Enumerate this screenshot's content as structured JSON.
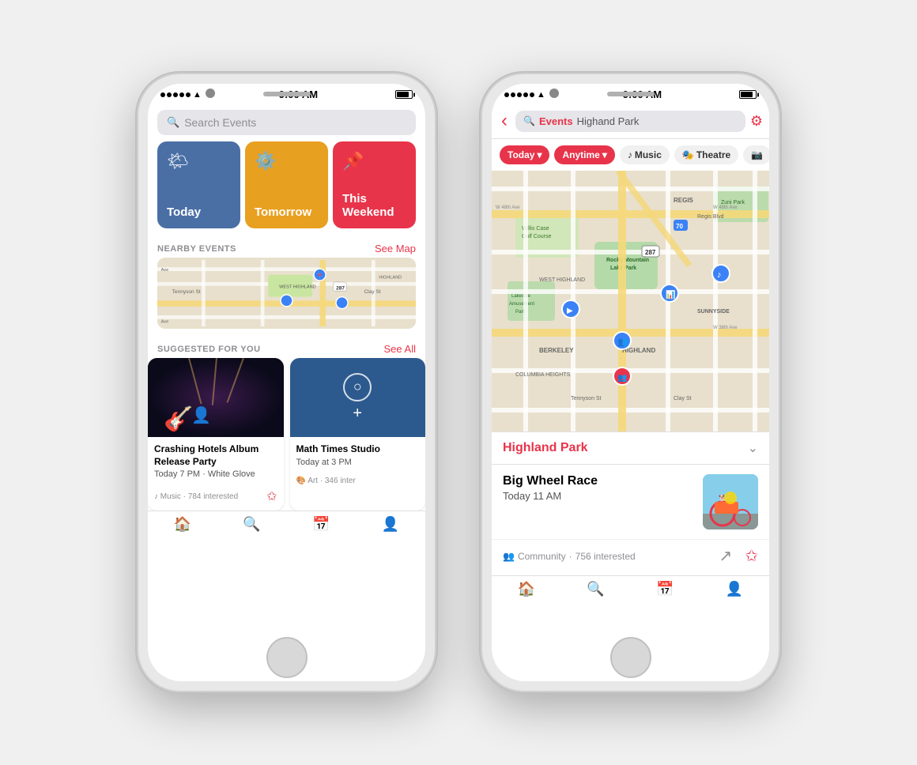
{
  "phone1": {
    "status": {
      "dots": 5,
      "wifi": "wifi",
      "time": "9:00 AM",
      "battery": "full"
    },
    "search": {
      "placeholder": "Search Events"
    },
    "timeCards": [
      {
        "id": "today",
        "label": "Today",
        "icon": "☁️",
        "color": "#4a6fa5"
      },
      {
        "id": "tomorrow",
        "label": "Tomorrow",
        "icon": "⚙️",
        "color": "#e8a020"
      },
      {
        "id": "weekend",
        "label": "This Weekend",
        "icon": "📌",
        "color": "#e8344a"
      }
    ],
    "nearby": {
      "title": "NEARBY EVENTS",
      "link": "See Map"
    },
    "suggested": {
      "title": "SUGGESTED FOR YOU",
      "link": "See All",
      "events": [
        {
          "title": "Crashing Hotels Album Release Party",
          "time": "Today 7 PM",
          "venue": "White Glove",
          "category": "Music",
          "interested": "784 interested"
        },
        {
          "title": "Math Times Studio",
          "time": "Today at 3 PM",
          "category": "Art",
          "interested": "346 inter"
        }
      ]
    },
    "tabs": [
      {
        "id": "home",
        "icon": "⌂",
        "active": false
      },
      {
        "id": "search",
        "icon": "⌕",
        "active": true
      },
      {
        "id": "calendar",
        "icon": "⬜",
        "active": false
      },
      {
        "id": "profile",
        "icon": "◯",
        "active": false
      }
    ]
  },
  "phone2": {
    "status": {
      "time": "9:00 AM"
    },
    "nav": {
      "brand": "Events",
      "location": "Highand Park",
      "back": "‹"
    },
    "filters": [
      {
        "id": "today",
        "label": "Today",
        "active": true
      },
      {
        "id": "anytime",
        "label": "Anytime",
        "active": true
      },
      {
        "id": "music",
        "label": "Music",
        "active": false,
        "icon": "♪"
      },
      {
        "id": "theatre",
        "label": "Theatre",
        "active": false,
        "icon": "🎭"
      },
      {
        "id": "more",
        "label": "…",
        "active": false
      }
    ],
    "map": {
      "area": "Highland Park",
      "labels": [
        "REGIS",
        "BERKELEY",
        "HIGHLAND",
        "SUNNYSIDE",
        "WEST HIGHLAND",
        "COLUMBIA HEIGHTS"
      ],
      "landmarks": [
        "Willis Case Golf Course",
        "Lakeside Amusement Park",
        "Rocky Mountain Lake Park",
        "Zuni Park"
      ],
      "highway": "287",
      "highway2": "70"
    },
    "location": {
      "name": "Highland Park",
      "chevron": "⌵"
    },
    "event": {
      "title": "Big Wheel Race",
      "time": "Today 11 AM",
      "community": "Community",
      "interested": "756 interested",
      "shareIcon": "share",
      "starIcon": "star"
    },
    "tabs": [
      {
        "id": "home",
        "icon": "⌂",
        "active": false
      },
      {
        "id": "search",
        "icon": "⌕",
        "active": true
      },
      {
        "id": "calendar",
        "icon": "⬜",
        "active": false
      },
      {
        "id": "profile",
        "icon": "◯",
        "active": false
      }
    ]
  }
}
